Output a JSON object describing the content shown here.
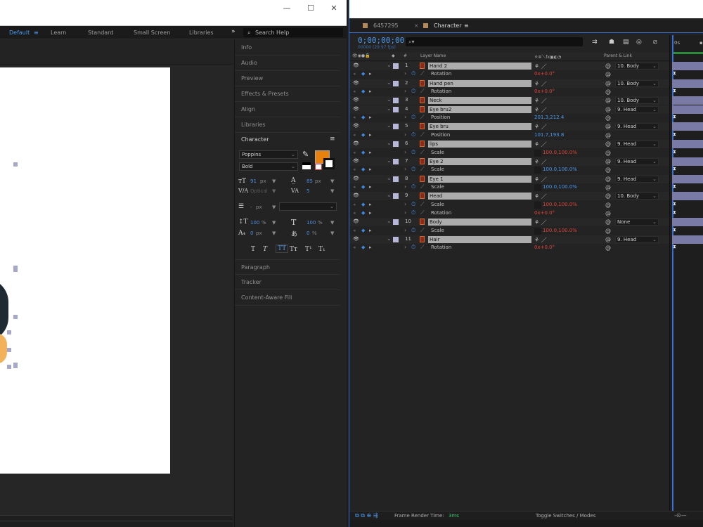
{
  "workspace": {
    "items": [
      "Default",
      "Learn",
      "Standard",
      "Small Screen",
      "Libraries"
    ],
    "search_placeholder": "Search Help"
  },
  "panels": {
    "collapsed_top": [
      "Info",
      "Audio",
      "Preview",
      "Effects & Presets",
      "Align",
      "Libraries"
    ],
    "character_title": "Character",
    "collapsed_bottom": [
      "Paragraph",
      "Tracker",
      "Content-Aware Fill"
    ]
  },
  "character": {
    "font_family": "Poppins",
    "font_style": "Bold",
    "font_size": "91",
    "font_size_unit": "px",
    "leading": "85",
    "leading_unit": "px",
    "kerning": "Optical",
    "tracking": "5",
    "stroke_width": "-",
    "stroke_unit": "px",
    "vert_scale": "100",
    "vert_scale_unit": "%",
    "horiz_scale": "100",
    "horiz_scale_unit": "%",
    "baseline": "0",
    "baseline_unit": "px",
    "tsume": "0",
    "tsume_unit": "%",
    "fill_color": "#e8820c",
    "style_glyphs": [
      "T",
      "T",
      "TT",
      "Tт",
      "T¹",
      "T₁"
    ]
  },
  "timeline": {
    "tabs": [
      "6457295",
      "Character"
    ],
    "timecode": "0;00;00;00",
    "fps": "00000 (29.97 fps)",
    "columns": {
      "num": "#",
      "layer_name": "Layer Name",
      "parent": "Parent & Link"
    },
    "layers": [
      {
        "num": "1",
        "name": "Hand 2",
        "parent": "10. Body",
        "prop": "Rotation",
        "value": "0x+0.0°",
        "value_color": "red"
      },
      {
        "num": "2",
        "name": "Hand pen",
        "parent": "10. Body",
        "prop": "Rotation",
        "value": "0x+0.0°",
        "value_color": "red"
      },
      {
        "num": "3",
        "name": "Neck",
        "parent": "10. Body"
      },
      {
        "num": "4",
        "name": "Eye bru2",
        "parent": "9. Head",
        "prop": "Position",
        "value": "201.3,212.4",
        "value_color": "blue"
      },
      {
        "num": "5",
        "name": "Eye bru",
        "parent": "9. Head",
        "prop": "Position",
        "value": "101.7,193.8",
        "value_color": "blue"
      },
      {
        "num": "6",
        "name": "lips",
        "parent": "9. Head",
        "prop": "Scale",
        "value": "100.0,100.0%",
        "value_color": "red"
      },
      {
        "num": "7",
        "name": "Eye 2",
        "parent": "9. Head",
        "prop": "Scale",
        "value": "100.0,100.0%",
        "value_color": "blue"
      },
      {
        "num": "8",
        "name": "Eye 1",
        "parent": "9. Head",
        "prop": "Scale",
        "value": "100.0,100.0%",
        "value_color": "blue"
      },
      {
        "num": "9",
        "name": "Head",
        "parent": "10. Body",
        "props": [
          {
            "prop": "Scale",
            "value": "100.0,100.0%",
            "value_color": "red"
          },
          {
            "prop": "Rotation",
            "value": "0x+0.0°",
            "value_color": "red"
          }
        ]
      },
      {
        "num": "10",
        "name": "Body",
        "parent": "None",
        "prop": "Scale",
        "value": "100.0,100.0%",
        "value_color": "red"
      },
      {
        "num": "11",
        "name": "Hair",
        "parent": "9. Head",
        "prop": "Rotation",
        "value": "0x+0.0°",
        "value_color": "red"
      }
    ],
    "ruler_start": "0s",
    "frame_render_label": "Frame Render Time:",
    "frame_render_value": "3ms",
    "toggle_label": "Toggle Switches / Modes"
  }
}
